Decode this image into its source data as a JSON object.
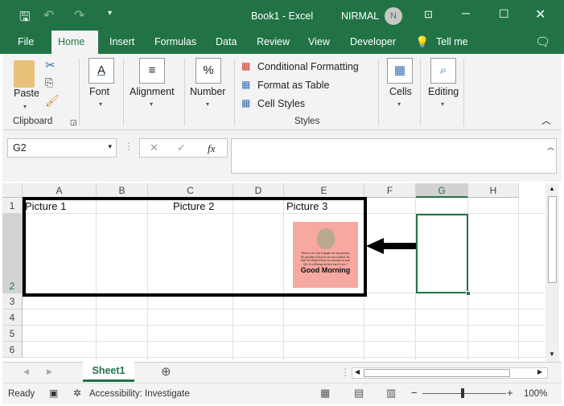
{
  "titlebar": {
    "title": "Book1  -  Excel",
    "user": "NIRMAL",
    "avatar_initial": "N"
  },
  "tabs": [
    "File",
    "Home",
    "Insert",
    "Formulas",
    "Data",
    "Review",
    "View",
    "Developer",
    "Tell me"
  ],
  "active_tab": "Home",
  "ribbon": {
    "clipboard": {
      "paste": "Paste",
      "label": "Clipboard"
    },
    "font": "Font",
    "alignment": "Alignment",
    "number": "Number",
    "number_icon": "%",
    "styles": {
      "conditional": "Conditional Formatting",
      "table": "Format as Table",
      "cellstyles": "Cell Styles",
      "label": "Styles"
    },
    "cells": "Cells",
    "editing": "Editing"
  },
  "formula_bar": {
    "name_box": "G2",
    "fx": "fx",
    "value": ""
  },
  "columns": [
    "A",
    "B",
    "C",
    "D",
    "E",
    "F",
    "G",
    "H"
  ],
  "rows": [
    "1",
    "2",
    "3",
    "4",
    "5",
    "6"
  ],
  "cells": {
    "A1": "Picture 1",
    "C1": "Picture 2",
    "E1": "Picture 3"
  },
  "selected_cell": "G2",
  "picture": {
    "caption": "Good Morning",
    "quote": "There is no wine if grapes are not pressed, No perfume if flowers are not crushed. So, don't be afraid if there are pressure in your life, It will bring the best out of you..!",
    "background": "#f7a8a0"
  },
  "sheet": {
    "tab": "Sheet1"
  },
  "status": {
    "ready": "Ready",
    "accessibility": "Accessibility: Investigate",
    "zoom": "100%"
  },
  "colors": {
    "accent": "#217346"
  }
}
